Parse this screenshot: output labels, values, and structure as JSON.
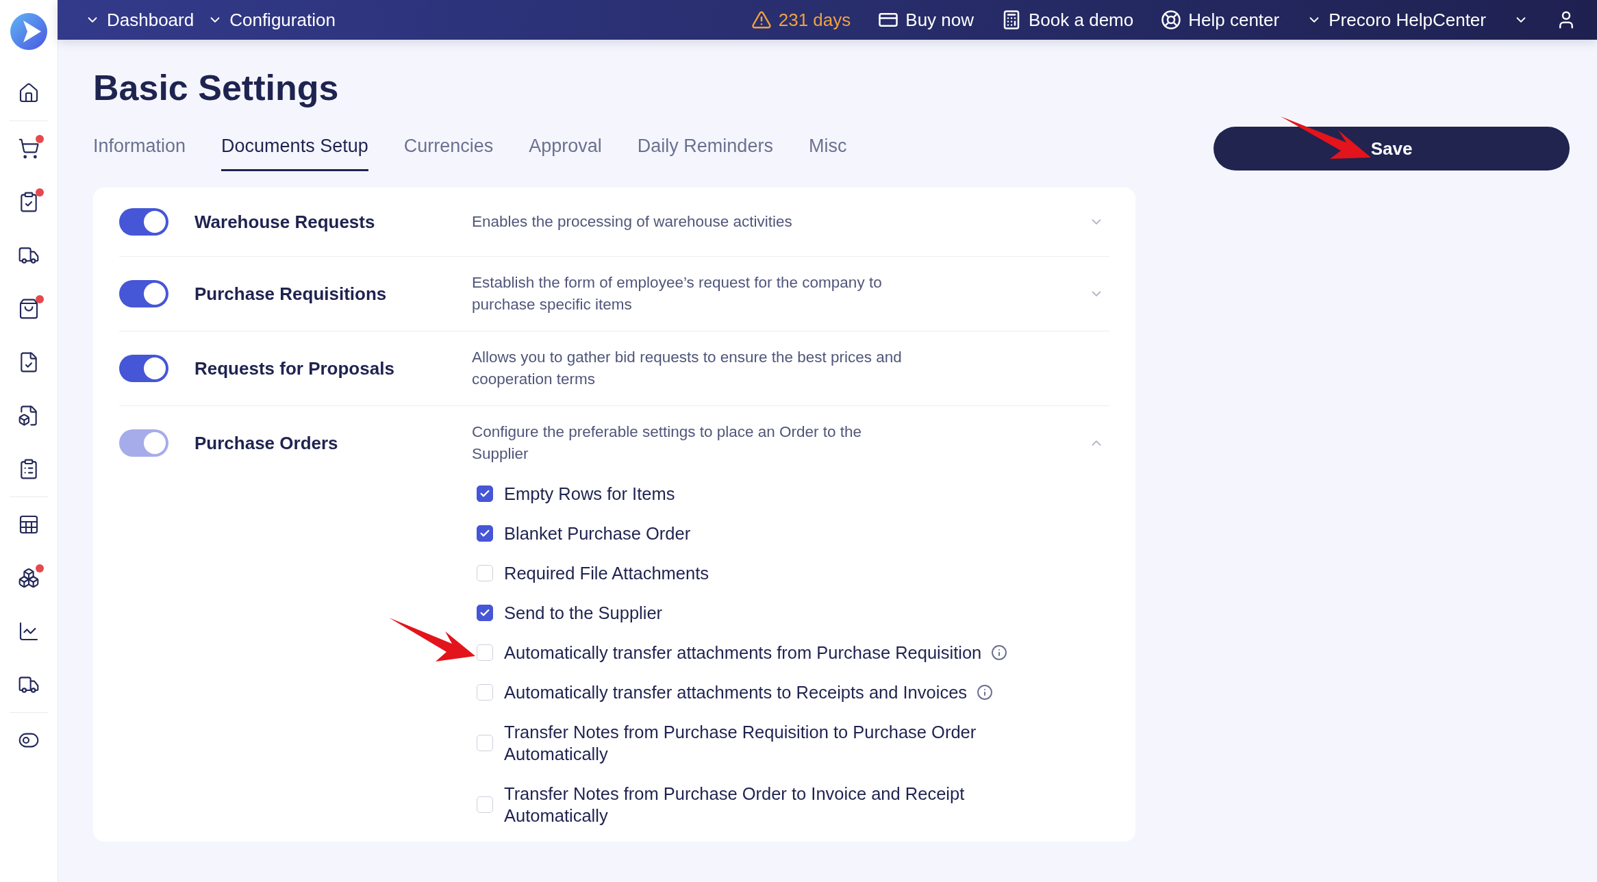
{
  "top_bar": {
    "items": [
      {
        "kind": "dropdown",
        "label": "Dashboard"
      },
      {
        "kind": "dropdown",
        "label": "Configuration"
      },
      {
        "kind": "warning",
        "label": "231 days"
      },
      {
        "kind": "link",
        "label": "Buy now"
      },
      {
        "kind": "link",
        "label": "Book a demo"
      },
      {
        "kind": "link",
        "label": "Help center"
      },
      {
        "kind": "dropdown",
        "label": "Precoro HelpCenter"
      },
      {
        "kind": "user"
      }
    ]
  },
  "sidebar": {
    "groups": [
      [
        {
          "badge": false
        }
      ],
      [
        {
          "badge": true
        },
        {
          "badge": true
        },
        {
          "badge": false
        },
        {
          "badge": true
        },
        {
          "badge": false
        },
        {
          "badge": false
        },
        {
          "badge": false
        }
      ],
      [
        {
          "badge": false
        },
        {
          "badge": true
        },
        {
          "badge": false
        },
        {
          "badge": false
        }
      ],
      [
        {
          "badge": false
        }
      ]
    ]
  },
  "page": {
    "title": "Basic Settings",
    "save_button": "Save"
  },
  "tabs": [
    {
      "label": "Information",
      "selected": false
    },
    {
      "label": "Documents Setup",
      "selected": true
    },
    {
      "label": "Currencies",
      "selected": false
    },
    {
      "label": "Approval",
      "selected": false
    },
    {
      "label": "Daily Reminders",
      "selected": false
    },
    {
      "label": "Misc",
      "selected": false
    }
  ],
  "settings": [
    {
      "name": "Warehouse Requests",
      "description": "Enables the processing of warehouse activities",
      "on": true,
      "disabled": false,
      "expanded": false
    },
    {
      "name": "Purchase Requisitions",
      "description": "Establish the form of employee’s request for the company to purchase specific items",
      "on": true,
      "disabled": false,
      "expanded": false
    },
    {
      "name": "Requests for Proposals",
      "description": "Allows you to gather bid requests to ensure the best prices and cooperation terms",
      "on": true,
      "disabled": false
    },
    {
      "name": "Purchase Orders",
      "description": "Configure the preferable settings to place an Order to the Supplier",
      "on": true,
      "disabled": true,
      "expanded": true,
      "options": [
        {
          "label": "Empty Rows for Items",
          "checked": true,
          "info": false
        },
        {
          "label": "Blanket Purchase Order",
          "checked": true,
          "info": false
        },
        {
          "label": "Required File Attachments",
          "checked": false,
          "info": false
        },
        {
          "label": "Send to the Supplier",
          "checked": true,
          "info": false
        },
        {
          "label": "Automatically transfer attachments from Purchase Requisition",
          "checked": false,
          "info": true
        },
        {
          "label": "Automatically transfer attachments to Receipts and Invoices",
          "checked": false,
          "info": true
        },
        {
          "label": "Transfer Notes from Purchase Requisition to Purchase Order Automatically",
          "checked": false,
          "info": false
        },
        {
          "label": "Transfer Notes from Purchase Order to Invoice and Receipt Automatically",
          "checked": false,
          "info": false
        }
      ]
    }
  ]
}
